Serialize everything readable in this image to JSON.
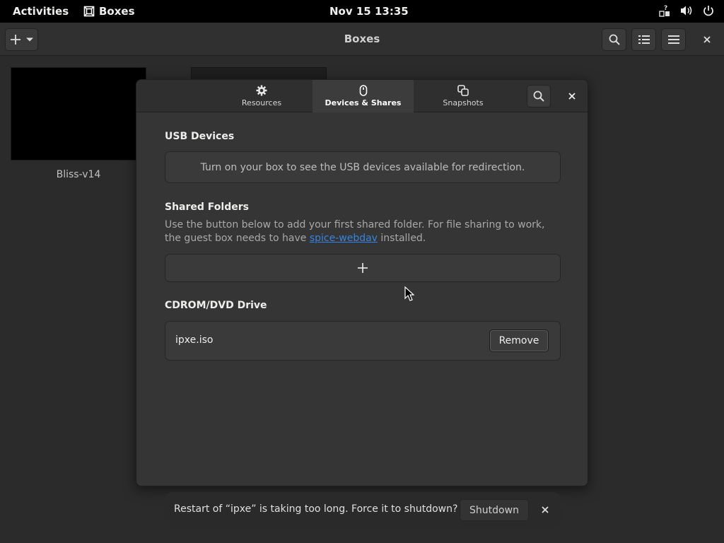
{
  "topbar": {
    "activities": "Activities",
    "app_name": "Boxes",
    "clock": "Nov 15  13:35"
  },
  "headerbar": {
    "title": "Boxes",
    "icons": [
      "plus-icon",
      "chevron-down-icon",
      "search-icon",
      "list-view-icon",
      "hamburger-menu-icon",
      "close-icon"
    ]
  },
  "boxes": [
    {
      "name": "Bliss-v14"
    }
  ],
  "dialog": {
    "tabs": [
      {
        "label": "Resources",
        "icon": "gear-icon"
      },
      {
        "label": "Devices & Shares",
        "icon": "mouse-icon",
        "active": true
      },
      {
        "label": "Snapshots",
        "icon": "snapshots-icon"
      }
    ],
    "usb": {
      "title": "USB Devices",
      "message": "Turn on your box to see the USB devices available for redirection."
    },
    "shared": {
      "title": "Shared Folders",
      "desc_before": "Use the button below to add your first shared folder. For file sharing to work, the guest box needs to have ",
      "link": "spice-webdav",
      "desc_after": " installed."
    },
    "cdrom": {
      "title": "CDROM/DVD Drive",
      "file": "ipxe.iso",
      "remove_label": "Remove"
    }
  },
  "notification": {
    "message": "Restart of “ipxe” is taking too long. Force it to shutdown?",
    "action_label": "Shutdown"
  },
  "colors": {
    "accent_link": "#3584e4",
    "dialog_bg": "#353535",
    "window_bg": "#2b2b2b"
  }
}
